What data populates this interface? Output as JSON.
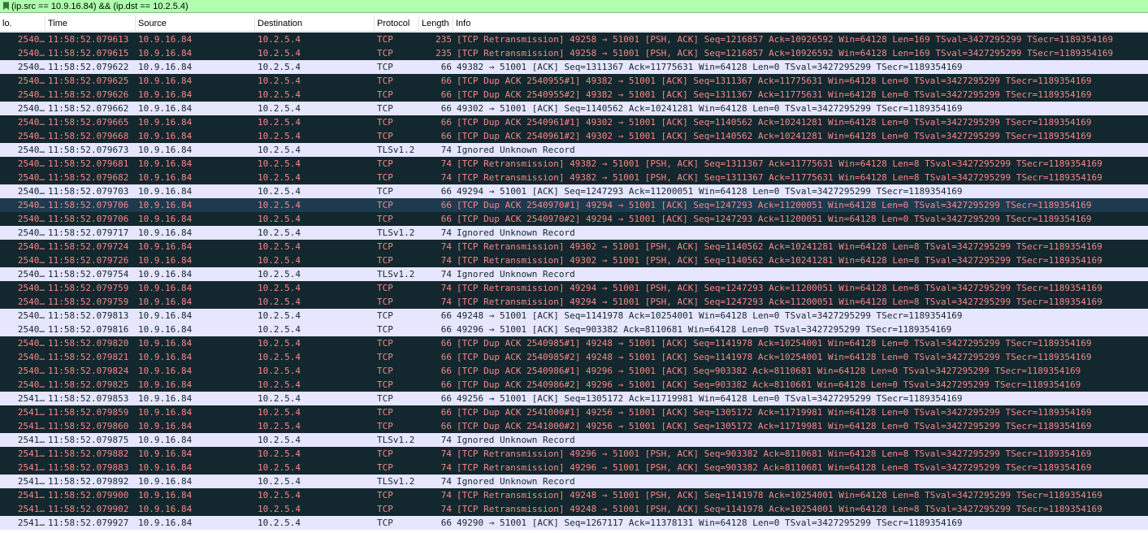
{
  "filter": {
    "value": "(ip.src == 10.9.16.84) && (ip.dst == 10.2.5.4)",
    "bookmark_icon": "filter-bookmark-icon",
    "color": "#afffaf"
  },
  "columns": [
    "lo.",
    "Time",
    "Source",
    "Destination",
    "Protocol",
    "Length",
    "Info"
  ],
  "colors": {
    "bad_bg": "#12272e",
    "bad_fg": "#f78787",
    "normal_bg": "#e7e6ff",
    "normal_fg": "#12272e",
    "selected_bg": "#1e3a4f"
  },
  "rows": [
    {
      "no": "2540…",
      "time": "11:58:52.079613",
      "src": "10.9.16.84",
      "dst": "10.2.5.4",
      "proto": "TCP",
      "len": "235",
      "info": "[TCP Retransmission] 49258 → 51001 [PSH, ACK] Seq=1216857 Ack=10926592 Win=64128 Len=169 TSval=3427295299 TSecr=1189354169",
      "style": "bad"
    },
    {
      "no": "2540…",
      "time": "11:58:52.079615",
      "src": "10.9.16.84",
      "dst": "10.2.5.4",
      "proto": "TCP",
      "len": "235",
      "info": "[TCP Retransmission] 49258 → 51001 [PSH, ACK] Seq=1216857 Ack=10926592 Win=64128 Len=169 TSval=3427295299 TSecr=1189354169",
      "style": "bad"
    },
    {
      "no": "2540…",
      "time": "11:58:52.079622",
      "src": "10.9.16.84",
      "dst": "10.2.5.4",
      "proto": "TCP",
      "len": "66",
      "info": "49382 → 51001 [ACK] Seq=1311367 Ack=11775631 Win=64128 Len=0 TSval=3427295299 TSecr=1189354169",
      "style": "normal"
    },
    {
      "no": "2540…",
      "time": "11:58:52.079625",
      "src": "10.9.16.84",
      "dst": "10.2.5.4",
      "proto": "TCP",
      "len": "66",
      "info": "[TCP Dup ACK 2540955#1] 49382 → 51001 [ACK] Seq=1311367 Ack=11775631 Win=64128 Len=0 TSval=3427295299 TSecr=1189354169",
      "style": "bad"
    },
    {
      "no": "2540…",
      "time": "11:58:52.079626",
      "src": "10.9.16.84",
      "dst": "10.2.5.4",
      "proto": "TCP",
      "len": "66",
      "info": "[TCP Dup ACK 2540955#2] 49382 → 51001 [ACK] Seq=1311367 Ack=11775631 Win=64128 Len=0 TSval=3427295299 TSecr=1189354169",
      "style": "bad"
    },
    {
      "no": "2540…",
      "time": "11:58:52.079662",
      "src": "10.9.16.84",
      "dst": "10.2.5.4",
      "proto": "TCP",
      "len": "66",
      "info": "49302 → 51001 [ACK] Seq=1140562 Ack=10241281 Win=64128 Len=0 TSval=3427295299 TSecr=1189354169",
      "style": "normal"
    },
    {
      "no": "2540…",
      "time": "11:58:52.079665",
      "src": "10.9.16.84",
      "dst": "10.2.5.4",
      "proto": "TCP",
      "len": "66",
      "info": "[TCP Dup ACK 2540961#1] 49302 → 51001 [ACK] Seq=1140562 Ack=10241281 Win=64128 Len=0 TSval=3427295299 TSecr=1189354169",
      "style": "bad"
    },
    {
      "no": "2540…",
      "time": "11:58:52.079668",
      "src": "10.9.16.84",
      "dst": "10.2.5.4",
      "proto": "TCP",
      "len": "66",
      "info": "[TCP Dup ACK 2540961#2] 49302 → 51001 [ACK] Seq=1140562 Ack=10241281 Win=64128 Len=0 TSval=3427295299 TSecr=1189354169",
      "style": "bad"
    },
    {
      "no": "2540…",
      "time": "11:58:52.079673",
      "src": "10.9.16.84",
      "dst": "10.2.5.4",
      "proto": "TLSv1.2",
      "len": "74",
      "info": "Ignored Unknown Record",
      "style": "normal"
    },
    {
      "no": "2540…",
      "time": "11:58:52.079681",
      "src": "10.9.16.84",
      "dst": "10.2.5.4",
      "proto": "TCP",
      "len": "74",
      "info": "[TCP Retransmission] 49382 → 51001 [PSH, ACK] Seq=1311367 Ack=11775631 Win=64128 Len=8 TSval=3427295299 TSecr=1189354169",
      "style": "bad"
    },
    {
      "no": "2540…",
      "time": "11:58:52.079682",
      "src": "10.9.16.84",
      "dst": "10.2.5.4",
      "proto": "TCP",
      "len": "74",
      "info": "[TCP Retransmission] 49382 → 51001 [PSH, ACK] Seq=1311367 Ack=11775631 Win=64128 Len=8 TSval=3427295299 TSecr=1189354169",
      "style": "bad"
    },
    {
      "no": "2540…",
      "time": "11:58:52.079703",
      "src": "10.9.16.84",
      "dst": "10.2.5.4",
      "proto": "TCP",
      "len": "66",
      "info": "49294 → 51001 [ACK] Seq=1247293 Ack=11200051 Win=64128 Len=0 TSval=3427295299 TSecr=1189354169",
      "style": "normal"
    },
    {
      "no": "2540…",
      "time": "11:58:52.079706",
      "src": "10.9.16.84",
      "dst": "10.2.5.4",
      "proto": "TCP",
      "len": "66",
      "info": "[TCP Dup ACK 2540970#1] 49294 → 51001 [ACK] Seq=1247293 Ack=11200051 Win=64128 Len=0 TSval=3427295299 TSecr=1189354169",
      "style": "selected"
    },
    {
      "no": "2540…",
      "time": "11:58:52.079706",
      "src": "10.9.16.84",
      "dst": "10.2.5.4",
      "proto": "TCP",
      "len": "66",
      "info": "[TCP Dup ACK 2540970#2] 49294 → 51001 [ACK] Seq=1247293 Ack=11200051 Win=64128 Len=0 TSval=3427295299 TSecr=1189354169",
      "style": "bad"
    },
    {
      "no": "2540…",
      "time": "11:58:52.079717",
      "src": "10.9.16.84",
      "dst": "10.2.5.4",
      "proto": "TLSv1.2",
      "len": "74",
      "info": "Ignored Unknown Record",
      "style": "normal"
    },
    {
      "no": "2540…",
      "time": "11:58:52.079724",
      "src": "10.9.16.84",
      "dst": "10.2.5.4",
      "proto": "TCP",
      "len": "74",
      "info": "[TCP Retransmission] 49302 → 51001 [PSH, ACK] Seq=1140562 Ack=10241281 Win=64128 Len=8 TSval=3427295299 TSecr=1189354169",
      "style": "bad"
    },
    {
      "no": "2540…",
      "time": "11:58:52.079726",
      "src": "10.9.16.84",
      "dst": "10.2.5.4",
      "proto": "TCP",
      "len": "74",
      "info": "[TCP Retransmission] 49302 → 51001 [PSH, ACK] Seq=1140562 Ack=10241281 Win=64128 Len=8 TSval=3427295299 TSecr=1189354169",
      "style": "bad"
    },
    {
      "no": "2540…",
      "time": "11:58:52.079754",
      "src": "10.9.16.84",
      "dst": "10.2.5.4",
      "proto": "TLSv1.2",
      "len": "74",
      "info": "Ignored Unknown Record",
      "style": "normal"
    },
    {
      "no": "2540…",
      "time": "11:58:52.079759",
      "src": "10.9.16.84",
      "dst": "10.2.5.4",
      "proto": "TCP",
      "len": "74",
      "info": "[TCP Retransmission] 49294 → 51001 [PSH, ACK] Seq=1247293 Ack=11200051 Win=64128 Len=8 TSval=3427295299 TSecr=1189354169",
      "style": "bad"
    },
    {
      "no": "2540…",
      "time": "11:58:52.079759",
      "src": "10.9.16.84",
      "dst": "10.2.5.4",
      "proto": "TCP",
      "len": "74",
      "info": "[TCP Retransmission] 49294 → 51001 [PSH, ACK] Seq=1247293 Ack=11200051 Win=64128 Len=8 TSval=3427295299 TSecr=1189354169",
      "style": "bad"
    },
    {
      "no": "2540…",
      "time": "11:58:52.079813",
      "src": "10.9.16.84",
      "dst": "10.2.5.4",
      "proto": "TCP",
      "len": "66",
      "info": "49248 → 51001 [ACK] Seq=1141978 Ack=10254001 Win=64128 Len=0 TSval=3427295299 TSecr=1189354169",
      "style": "normal"
    },
    {
      "no": "2540…",
      "time": "11:58:52.079816",
      "src": "10.9.16.84",
      "dst": "10.2.5.4",
      "proto": "TCP",
      "len": "66",
      "info": "49296 → 51001 [ACK] Seq=903382 Ack=8110681 Win=64128 Len=0 TSval=3427295299 TSecr=1189354169",
      "style": "normal"
    },
    {
      "no": "2540…",
      "time": "11:58:52.079820",
      "src": "10.9.16.84",
      "dst": "10.2.5.4",
      "proto": "TCP",
      "len": "66",
      "info": "[TCP Dup ACK 2540985#1] 49248 → 51001 [ACK] Seq=1141978 Ack=10254001 Win=64128 Len=0 TSval=3427295299 TSecr=1189354169",
      "style": "bad"
    },
    {
      "no": "2540…",
      "time": "11:58:52.079821",
      "src": "10.9.16.84",
      "dst": "10.2.5.4",
      "proto": "TCP",
      "len": "66",
      "info": "[TCP Dup ACK 2540985#2] 49248 → 51001 [ACK] Seq=1141978 Ack=10254001 Win=64128 Len=0 TSval=3427295299 TSecr=1189354169",
      "style": "bad"
    },
    {
      "no": "2540…",
      "time": "11:58:52.079824",
      "src": "10.9.16.84",
      "dst": "10.2.5.4",
      "proto": "TCP",
      "len": "66",
      "info": "[TCP Dup ACK 2540986#1] 49296 → 51001 [ACK] Seq=903382 Ack=8110681 Win=64128 Len=0 TSval=3427295299 TSecr=1189354169",
      "style": "bad"
    },
    {
      "no": "2540…",
      "time": "11:58:52.079825",
      "src": "10.9.16.84",
      "dst": "10.2.5.4",
      "proto": "TCP",
      "len": "66",
      "info": "[TCP Dup ACK 2540986#2] 49296 → 51001 [ACK] Seq=903382 Ack=8110681 Win=64128 Len=0 TSval=3427295299 TSecr=1189354169",
      "style": "bad"
    },
    {
      "no": "2541…",
      "time": "11:58:52.079853",
      "src": "10.9.16.84",
      "dst": "10.2.5.4",
      "proto": "TCP",
      "len": "66",
      "info": "49256 → 51001 [ACK] Seq=1305172 Ack=11719981 Win=64128 Len=0 TSval=3427295299 TSecr=1189354169",
      "style": "normal"
    },
    {
      "no": "2541…",
      "time": "11:58:52.079859",
      "src": "10.9.16.84",
      "dst": "10.2.5.4",
      "proto": "TCP",
      "len": "66",
      "info": "[TCP Dup ACK 2541000#1] 49256 → 51001 [ACK] Seq=1305172 Ack=11719981 Win=64128 Len=0 TSval=3427295299 TSecr=1189354169",
      "style": "bad"
    },
    {
      "no": "2541…",
      "time": "11:58:52.079860",
      "src": "10.9.16.84",
      "dst": "10.2.5.4",
      "proto": "TCP",
      "len": "66",
      "info": "[TCP Dup ACK 2541000#2] 49256 → 51001 [ACK] Seq=1305172 Ack=11719981 Win=64128 Len=0 TSval=3427295299 TSecr=1189354169",
      "style": "bad"
    },
    {
      "no": "2541…",
      "time": "11:58:52.079875",
      "src": "10.9.16.84",
      "dst": "10.2.5.4",
      "proto": "TLSv1.2",
      "len": "74",
      "info": "Ignored Unknown Record",
      "style": "normal"
    },
    {
      "no": "2541…",
      "time": "11:58:52.079882",
      "src": "10.9.16.84",
      "dst": "10.2.5.4",
      "proto": "TCP",
      "len": "74",
      "info": "[TCP Retransmission] 49296 → 51001 [PSH, ACK] Seq=903382 Ack=8110681 Win=64128 Len=8 TSval=3427295299 TSecr=1189354169",
      "style": "bad"
    },
    {
      "no": "2541…",
      "time": "11:58:52.079883",
      "src": "10.9.16.84",
      "dst": "10.2.5.4",
      "proto": "TCP",
      "len": "74",
      "info": "[TCP Retransmission] 49296 → 51001 [PSH, ACK] Seq=903382 Ack=8110681 Win=64128 Len=8 TSval=3427295299 TSecr=1189354169",
      "style": "bad"
    },
    {
      "no": "2541…",
      "time": "11:58:52.079892",
      "src": "10.9.16.84",
      "dst": "10.2.5.4",
      "proto": "TLSv1.2",
      "len": "74",
      "info": "Ignored Unknown Record",
      "style": "normal"
    },
    {
      "no": "2541…",
      "time": "11:58:52.079900",
      "src": "10.9.16.84",
      "dst": "10.2.5.4",
      "proto": "TCP",
      "len": "74",
      "info": "[TCP Retransmission] 49248 → 51001 [PSH, ACK] Seq=1141978 Ack=10254001 Win=64128 Len=8 TSval=3427295299 TSecr=1189354169",
      "style": "bad"
    },
    {
      "no": "2541…",
      "time": "11:58:52.079902",
      "src": "10.9.16.84",
      "dst": "10.2.5.4",
      "proto": "TCP",
      "len": "74",
      "info": "[TCP Retransmission] 49248 → 51001 [PSH, ACK] Seq=1141978 Ack=10254001 Win=64128 Len=8 TSval=3427295299 TSecr=1189354169",
      "style": "bad"
    },
    {
      "no": "2541…",
      "time": "11:58:52.079927",
      "src": "10.9.16.84",
      "dst": "10.2.5.4",
      "proto": "TCP",
      "len": "66",
      "info": "49290 → 51001 [ACK] Seq=1267117 Ack=11378131 Win=64128 Len=0 TSval=3427295299 TSecr=1189354169",
      "style": "normal"
    }
  ]
}
